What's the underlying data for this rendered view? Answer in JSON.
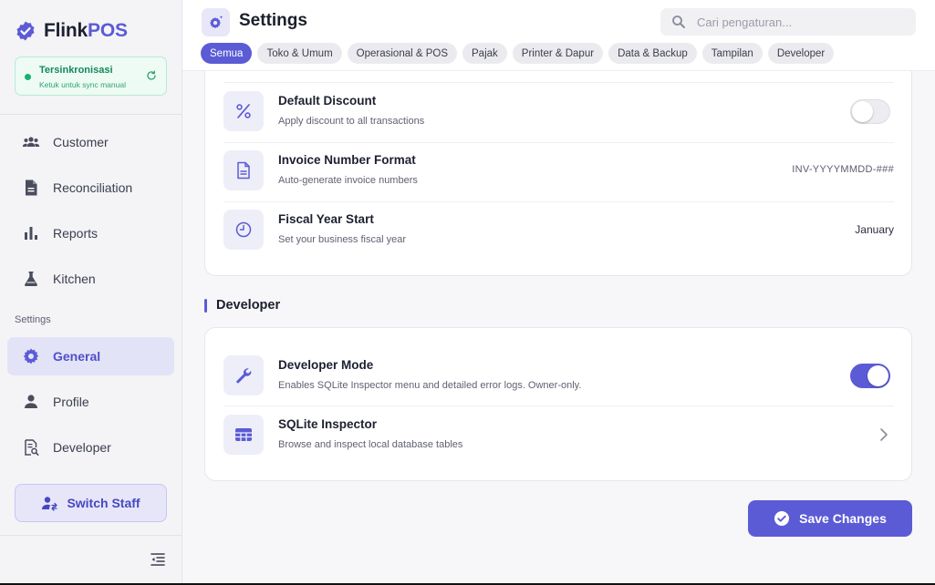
{
  "brand": {
    "name_part1": "Flink",
    "name_part2": "POS"
  },
  "sync": {
    "title": "Tersinkronisasi",
    "subtitle": "Ketuk untuk sync manual"
  },
  "sidebar": {
    "items": [
      {
        "label": "Customer",
        "icon": "people-icon"
      },
      {
        "label": "Reconciliation",
        "icon": "document-icon"
      },
      {
        "label": "Reports",
        "icon": "bar-chart-icon"
      },
      {
        "label": "Kitchen",
        "icon": "flask-icon"
      }
    ],
    "section_label": "Settings",
    "settings_items": [
      {
        "label": "General",
        "icon": "gear-icon",
        "active": true
      },
      {
        "label": "Profile",
        "icon": "person-icon"
      },
      {
        "label": "Developer",
        "icon": "doc-search-icon"
      }
    ],
    "switch_staff": "Switch Staff"
  },
  "header": {
    "title": "Settings",
    "search_placeholder": "Cari pengaturan..."
  },
  "tabs": [
    {
      "label": "Semua",
      "active": true
    },
    {
      "label": "Toko & Umum"
    },
    {
      "label": "Operasional & POS"
    },
    {
      "label": "Pajak"
    },
    {
      "label": "Printer & Dapur"
    },
    {
      "label": "Data & Backup"
    },
    {
      "label": "Tampilan"
    },
    {
      "label": "Developer"
    }
  ],
  "general_rows": {
    "discount": {
      "title": "Default Discount",
      "subtitle": "Apply discount to all transactions",
      "enabled": false
    },
    "invoice": {
      "title": "Invoice Number Format",
      "subtitle": "Auto-generate invoice numbers",
      "value": "INV-YYYYMMDD-###"
    },
    "fiscal": {
      "title": "Fiscal Year Start",
      "subtitle": "Set your business fiscal year",
      "value": "January"
    }
  },
  "developer_section": {
    "title": "Developer",
    "dev_mode": {
      "title": "Developer Mode",
      "subtitle": "Enables SQLite Inspector menu and detailed error logs. Owner-only.",
      "enabled": true
    },
    "sqlite": {
      "title": "SQLite Inspector",
      "subtitle": "Browse and inspect local database tables"
    }
  },
  "save_button": "Save Changes",
  "colors": {
    "accent": "#5b5bd6",
    "sync_green": "#16b273"
  }
}
